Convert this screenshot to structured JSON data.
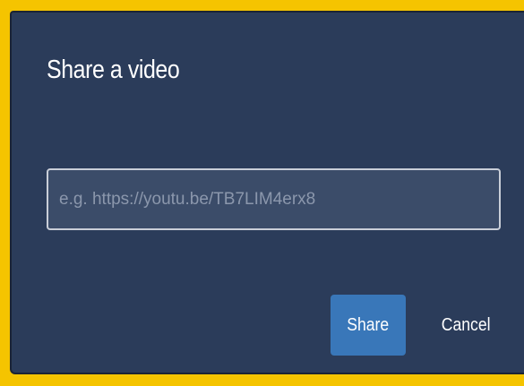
{
  "dialog": {
    "title": "Share a video",
    "url_input": {
      "value": "",
      "placeholder": "e.g. https://youtu.be/TB7LIM4erx8"
    },
    "share_label": "Share",
    "cancel_label": "Cancel"
  },
  "colors": {
    "frame_highlight": "#f5c400",
    "dialog_background": "#2b3c5a",
    "input_background": "#3b4c69",
    "primary_button": "#3977b9",
    "text": "#ffffff",
    "placeholder_text": "#8b97ac"
  }
}
